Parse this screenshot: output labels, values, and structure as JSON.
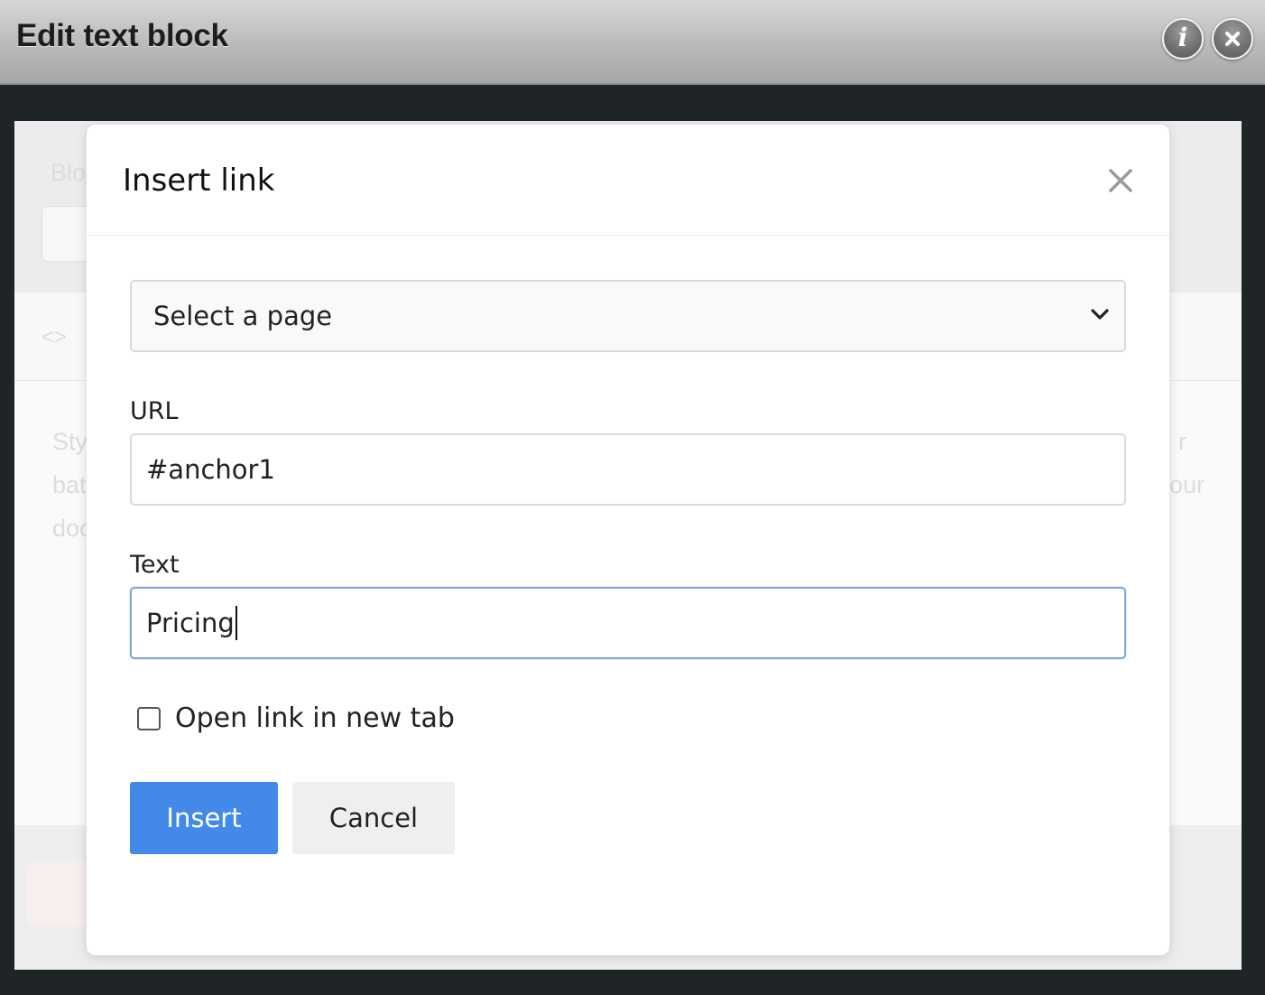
{
  "window": {
    "title": "Edit text block",
    "info_icon": "info-icon",
    "close_icon": "close-icon"
  },
  "background_page": {
    "ghost_label": "Blo",
    "ghost_code_icon": "<>",
    "ghost_lines": [
      "Sty",
      "bat",
      "doc"
    ],
    "ghost_right_lines": [
      "r",
      "our"
    ]
  },
  "modal": {
    "title": "Insert link",
    "close_icon": "close-icon",
    "page_select": {
      "selected": "Select a page",
      "icon": "chevron-down-icon"
    },
    "url": {
      "label": "URL",
      "value": "#anchor1"
    },
    "text": {
      "label": "Text",
      "value": "Pricing"
    },
    "open_new_tab": {
      "label": "Open link in new tab",
      "checked": false
    },
    "buttons": {
      "insert": "Insert",
      "cancel": "Cancel"
    }
  },
  "colors": {
    "primary": "#4289e8",
    "secondary_button": "#efefef",
    "focus_border": "#7ea6d9",
    "backdrop": "#1f2427"
  }
}
